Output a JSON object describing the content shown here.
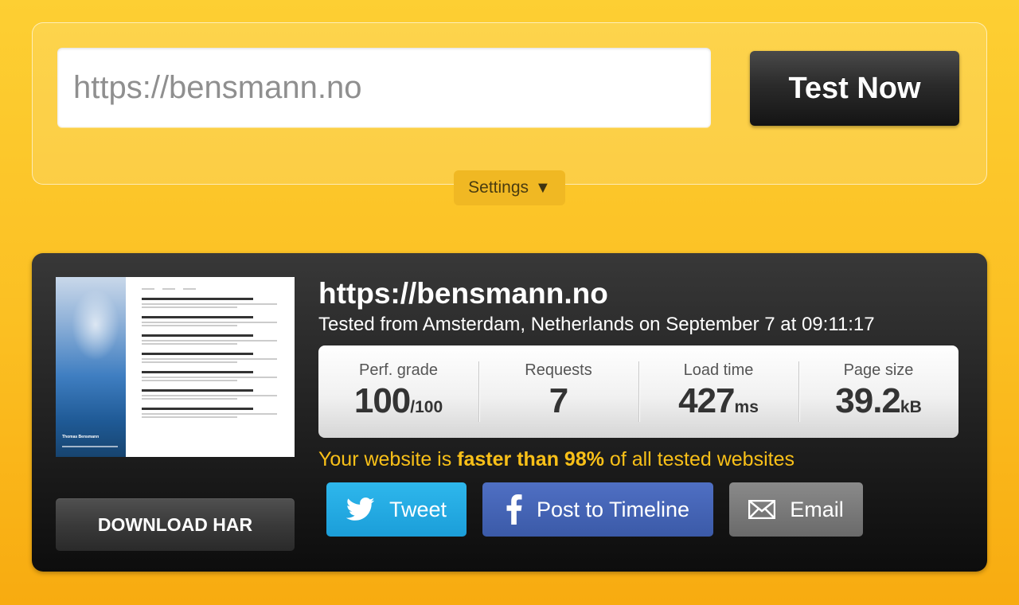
{
  "test_form": {
    "url_placeholder": "https://bensmann.no",
    "test_button_label": "Test Now",
    "settings_label": "Settings",
    "settings_caret": "▼"
  },
  "result": {
    "url": "https://bensmann.no",
    "tested_from": "Tested from Amsterdam, Netherlands on September 7 at 09:11:17",
    "download_har_label": "DOWNLOAD HAR",
    "thumbnail_title": "Thomas Bensmann",
    "stats": [
      {
        "label": "Perf. grade",
        "value": "100",
        "unit": "/100"
      },
      {
        "label": "Requests",
        "value": "7",
        "unit": ""
      },
      {
        "label": "Load time",
        "value": "427",
        "unit": "ms"
      },
      {
        "label": "Page size",
        "value": "39.2",
        "unit": "kB"
      }
    ],
    "summary": {
      "prefix": "Your website is ",
      "highlight": "faster than 98%",
      "suffix": " of all tested websites"
    },
    "share": {
      "tweet_label": "Tweet",
      "facebook_label": "Post to Timeline",
      "email_label": "Email"
    }
  },
  "colors": {
    "background_top": "#fdcf33",
    "background_bottom": "#f8ab10",
    "summary_text": "#f9c018",
    "twitter": "#1b9ed9",
    "facebook": "#3b5aa8",
    "email": "#6a6a6a"
  },
  "icons": {
    "tweet": "twitter-bird-icon",
    "facebook": "facebook-f-icon",
    "email": "envelope-icon",
    "settings": "caret-down-icon"
  }
}
